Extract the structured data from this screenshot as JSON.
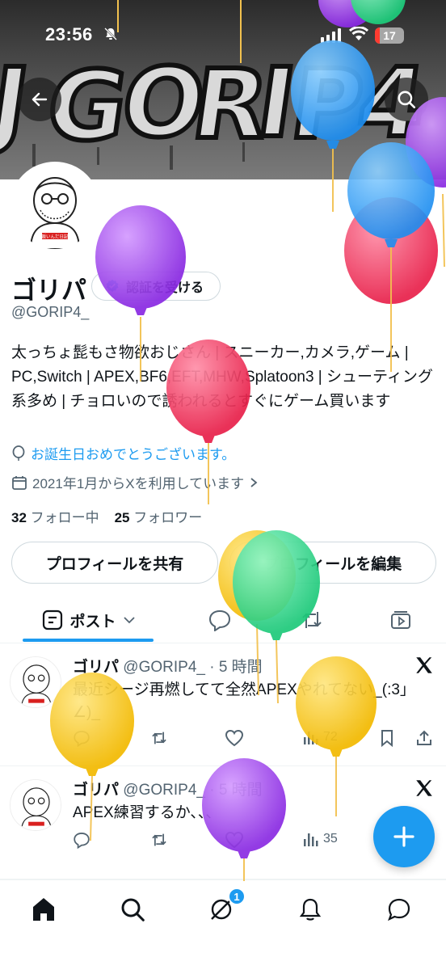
{
  "status_bar": {
    "time": "23:56",
    "battery": "17"
  },
  "colors": {
    "accent": "#1d9bf0",
    "text_primary": "#0f1419",
    "text_secondary": "#536471",
    "battery_low": "#ff3b30"
  },
  "banner": {
    "text": "GORIP4"
  },
  "profile": {
    "name": "ゴリパ",
    "verify_label": "認証を受ける",
    "handle": "@GORIP4_",
    "bio": "太っちょ髭もさ物欲おじさん | スニーカー,カメラ,ゲーム | PC,Switch | APEX,BF6,EFT,MHW,Splatoon3 | シューティング系多め | チョロいので誘われるとすぐにゲーム買います",
    "birthday": "お誕生日おめでとうございます。",
    "joined": "2021年1月からXを利用しています",
    "following_count": "32",
    "following_label": "フォロー中",
    "followers_count": "25",
    "followers_label": "フォロワー",
    "share_label": "プロフィールを共有",
    "edit_label": "プロフィールを編集",
    "avatar_shirt_text": "飯いんだ日記"
  },
  "tabs": {
    "posts_label": "ポスト"
  },
  "tweets": [
    {
      "name": "ゴリパ",
      "meta": "@GORIP4_ · 5 時間",
      "text": "最近シージ再燃してて全然APEXやれてない_(:3」∠)_",
      "views": "72"
    },
    {
      "name": "ゴリパ",
      "meta": "@GORIP4_ · 5 時間",
      "text": "APEX練習するか、、、",
      "views": "35"
    }
  ],
  "nav": {
    "grok_badge": "1"
  },
  "icons": [
    "back-arrow-icon",
    "search-icon",
    "verified-badge-icon",
    "balloon-icon",
    "calendar-icon",
    "chevron-right-icon",
    "post-tab-icon",
    "chevron-down-icon",
    "reply-icon",
    "repost-icon",
    "media-icon",
    "x-logo-icon",
    "like-icon",
    "views-icon",
    "bookmark-icon",
    "share-icon",
    "home-icon",
    "grok-icon",
    "bell-icon",
    "chat-icon",
    "plus-icon"
  ]
}
